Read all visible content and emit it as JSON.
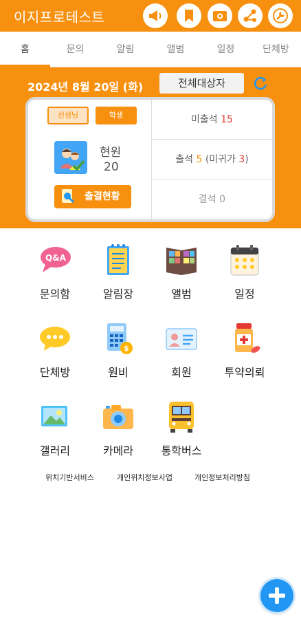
{
  "app": {
    "title": "이지프로테스트"
  },
  "tabs": [
    {
      "label": "홈"
    },
    {
      "label": "문의"
    },
    {
      "label": "알림"
    },
    {
      "label": "앨범"
    },
    {
      "label": "일정"
    },
    {
      "label": "단체방"
    }
  ],
  "summary": {
    "date": "2024년 8월 20일 (화)",
    "target_button": "전체대상자",
    "roles": {
      "teacher": "선생님",
      "student": "학생"
    },
    "current_label": "현원",
    "current_value": "20",
    "attendance_button": "출결현황",
    "not_checked_label": "미출석",
    "not_checked_value": "15",
    "present_label": "출석",
    "present_value": "5",
    "not_returned_label": "미귀가",
    "not_returned_value": "3",
    "absent_label": "결석",
    "absent_value": "0"
  },
  "menu": [
    {
      "label": "문의함",
      "icon": "qa-bubble-icon"
    },
    {
      "label": "알림장",
      "icon": "notebook-icon"
    },
    {
      "label": "앨범",
      "icon": "photo-album-icon"
    },
    {
      "label": "일정",
      "icon": "calendar-icon"
    },
    {
      "label": "단체방",
      "icon": "chat-bubble-icon"
    },
    {
      "label": "원비",
      "icon": "calculator-icon"
    },
    {
      "label": "회원",
      "icon": "id-card-icon"
    },
    {
      "label": "투약의뢰",
      "icon": "medicine-icon"
    },
    {
      "label": "갤러리",
      "icon": "gallery-icon"
    },
    {
      "label": "카메라",
      "icon": "camera-icon"
    },
    {
      "label": "통학버스",
      "icon": "school-bus-icon"
    }
  ],
  "footer_links": {
    "location_service": "위치기반서비스",
    "location_business": "개인위치정보사업",
    "privacy_policy": "개인정보처리방침"
  },
  "colors": {
    "accent": "#f7900e",
    "highlight_red": "#e53935",
    "fab": "#2196f3"
  }
}
